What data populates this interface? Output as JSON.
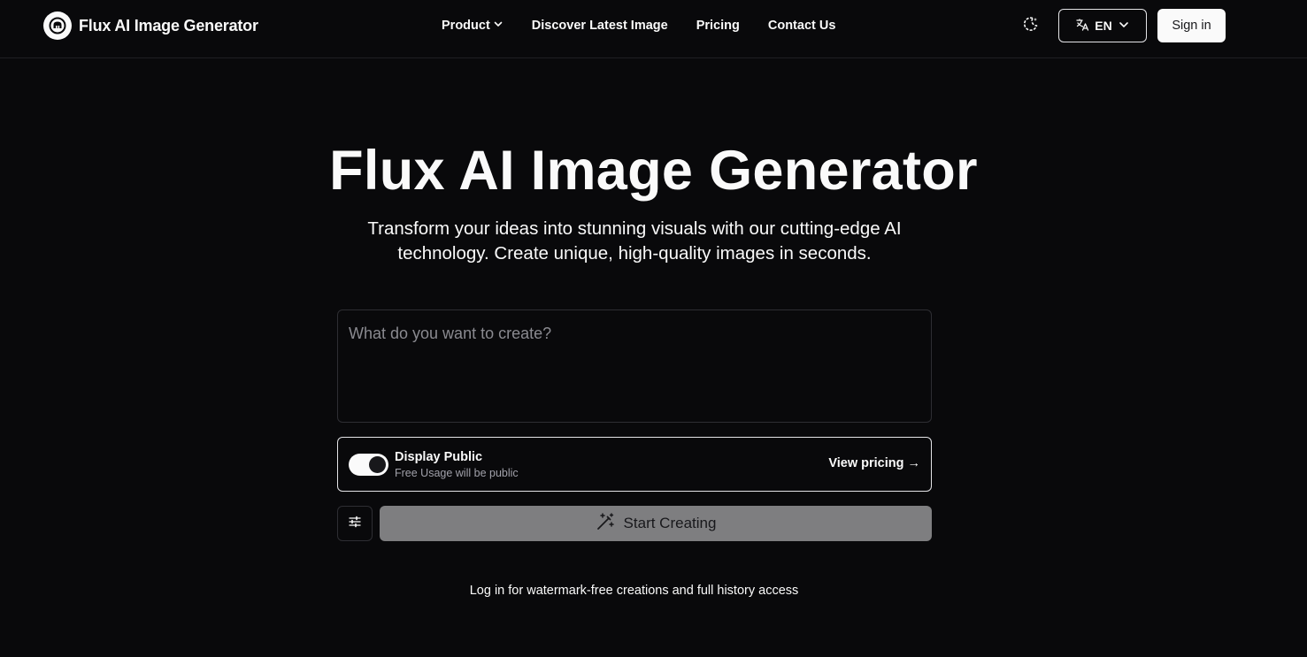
{
  "header": {
    "brand_name": "Flux AI Image Generator",
    "brand_icon": "flux-logo-icon",
    "nav": [
      {
        "label": "Product",
        "has_dropdown": true
      },
      {
        "label": "Discover Latest Image"
      },
      {
        "label": "Pricing"
      },
      {
        "label": "Contact Us"
      }
    ],
    "theme_icon": "moon-icon",
    "language": {
      "label": "EN",
      "icon": "translate-icon"
    },
    "signin_label": "Sign in"
  },
  "hero": {
    "title": "Flux AI Image Generator",
    "subtitle": "Transform your ideas into stunning visuals with our cutting-edge AI technology. Create unique, high-quality images in seconds."
  },
  "prompt": {
    "placeholder": "What do you want to create?",
    "value": ""
  },
  "public_toggle": {
    "title": "Display Public",
    "description": "Free Usage will be public",
    "enabled": true,
    "pricing_link": "View pricing →"
  },
  "actions": {
    "settings_icon": "sliders-icon",
    "start_label": "Start Creating",
    "start_icon": "magic-wand-icon"
  },
  "footer_note": "Log in for watermark-free creations and full history access",
  "colors": {
    "background": "#09090b",
    "text": "#fafafa",
    "muted": "#a1a1aa",
    "start_button": "#7e7e80"
  }
}
